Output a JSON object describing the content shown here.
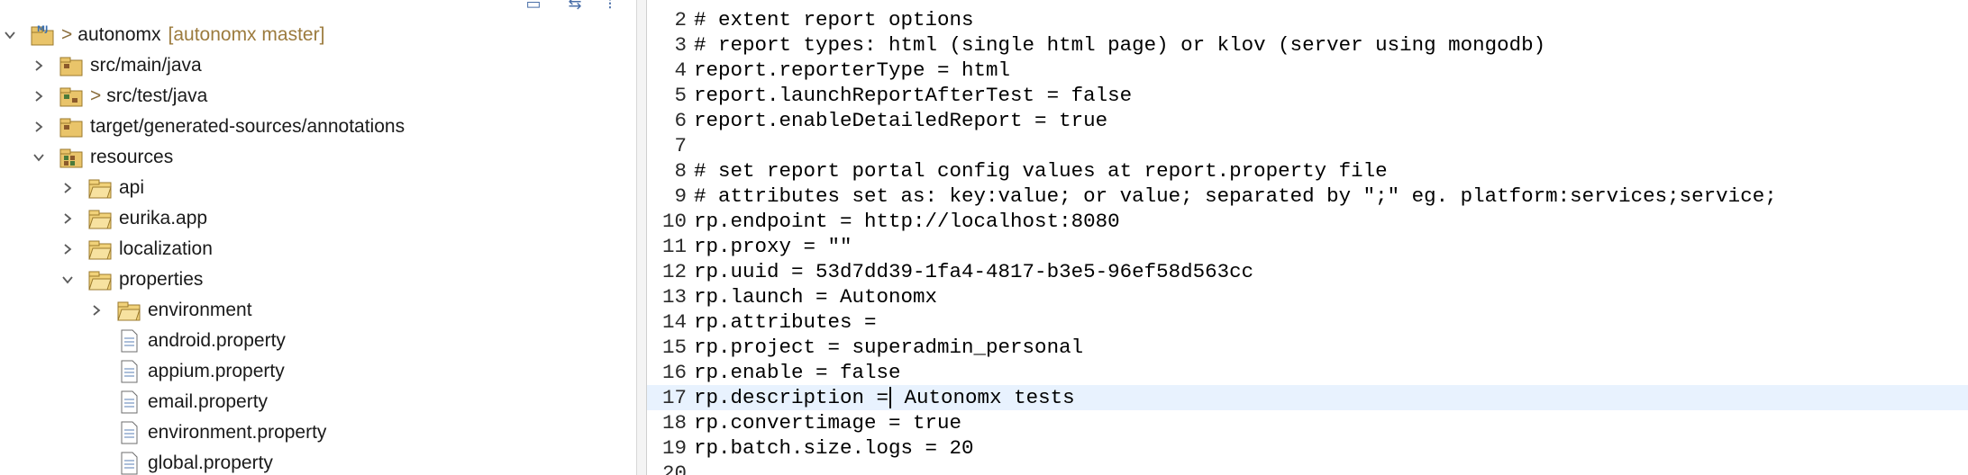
{
  "explorer": {
    "project": {
      "name": "autonomx",
      "branch": "[autonomx master]",
      "prefix": ">"
    },
    "items": [
      {
        "label": "src/main/java",
        "indent": 1,
        "expanded": false,
        "icon": "source-folder-icon",
        "decorated": false
      },
      {
        "label": "src/test/java",
        "indent": 1,
        "expanded": false,
        "icon": "source-folder-icon",
        "decorated": true,
        "prefix": ">"
      },
      {
        "label": "target/generated-sources/annotations",
        "indent": 1,
        "expanded": false,
        "icon": "source-folder-icon"
      },
      {
        "label": "resources",
        "indent": 1,
        "expanded": true,
        "icon": "resource-folder-icon"
      },
      {
        "label": "api",
        "indent": 2,
        "expanded": false,
        "icon": "folder-icon"
      },
      {
        "label": "eurika.app",
        "indent": 2,
        "expanded": false,
        "icon": "folder-icon"
      },
      {
        "label": "localization",
        "indent": 2,
        "expanded": false,
        "icon": "folder-icon"
      },
      {
        "label": "properties",
        "indent": 2,
        "expanded": true,
        "icon": "folder-icon"
      },
      {
        "label": "environment",
        "indent": 3,
        "expanded": false,
        "icon": "folder-icon"
      },
      {
        "label": "android.property",
        "indent": 3,
        "file": true,
        "icon": "file-icon"
      },
      {
        "label": "appium.property",
        "indent": 3,
        "file": true,
        "icon": "file-icon"
      },
      {
        "label": "email.property",
        "indent": 3,
        "file": true,
        "icon": "file-icon"
      },
      {
        "label": "environment.property",
        "indent": 3,
        "file": true,
        "icon": "file-icon"
      },
      {
        "label": "global.property",
        "indent": 3,
        "file": true,
        "icon": "file-icon"
      }
    ]
  },
  "editor": {
    "current_line": 17,
    "lines": [
      {
        "n": "2",
        "text": "# extent report options"
      },
      {
        "n": "3",
        "text": "# report types: html (single html page) or klov (server using mongodb)"
      },
      {
        "n": "4",
        "text": "report.reporterType = html"
      },
      {
        "n": "5",
        "text": "report.launchReportAfterTest = false"
      },
      {
        "n": "6",
        "text": "report.enableDetailedReport = true"
      },
      {
        "n": "7",
        "text": ""
      },
      {
        "n": "8",
        "text": "# set report portal config values at report.property file"
      },
      {
        "n": "9",
        "text": "# attributes set as: key:value; or value; separated by \";\" eg. platform:services;service;"
      },
      {
        "n": "10",
        "text": "rp.endpoint = http://localhost:8080"
      },
      {
        "n": "11",
        "text": "rp.proxy = \"\""
      },
      {
        "n": "12",
        "text": "rp.uuid = 53d7dd39-1fa4-4817-b3e5-96ef58d563cc"
      },
      {
        "n": "13",
        "text": "rp.launch = Autonomx"
      },
      {
        "n": "14",
        "text": "rp.attributes ="
      },
      {
        "n": "15",
        "text": "rp.project = superadmin_personal"
      },
      {
        "n": "16",
        "text": "rp.enable = false"
      },
      {
        "n": "17",
        "text_before": "rp.description =",
        "text_after": " Autonomx tests"
      },
      {
        "n": "18",
        "text": "rp.convertimage = true"
      },
      {
        "n": "19",
        "text": "rp.batch.size.logs = 20"
      },
      {
        "n": "20",
        "text": ""
      }
    ]
  },
  "colors": {
    "current_line": "#e8f2fe",
    "branch": "#9c7b3e"
  }
}
